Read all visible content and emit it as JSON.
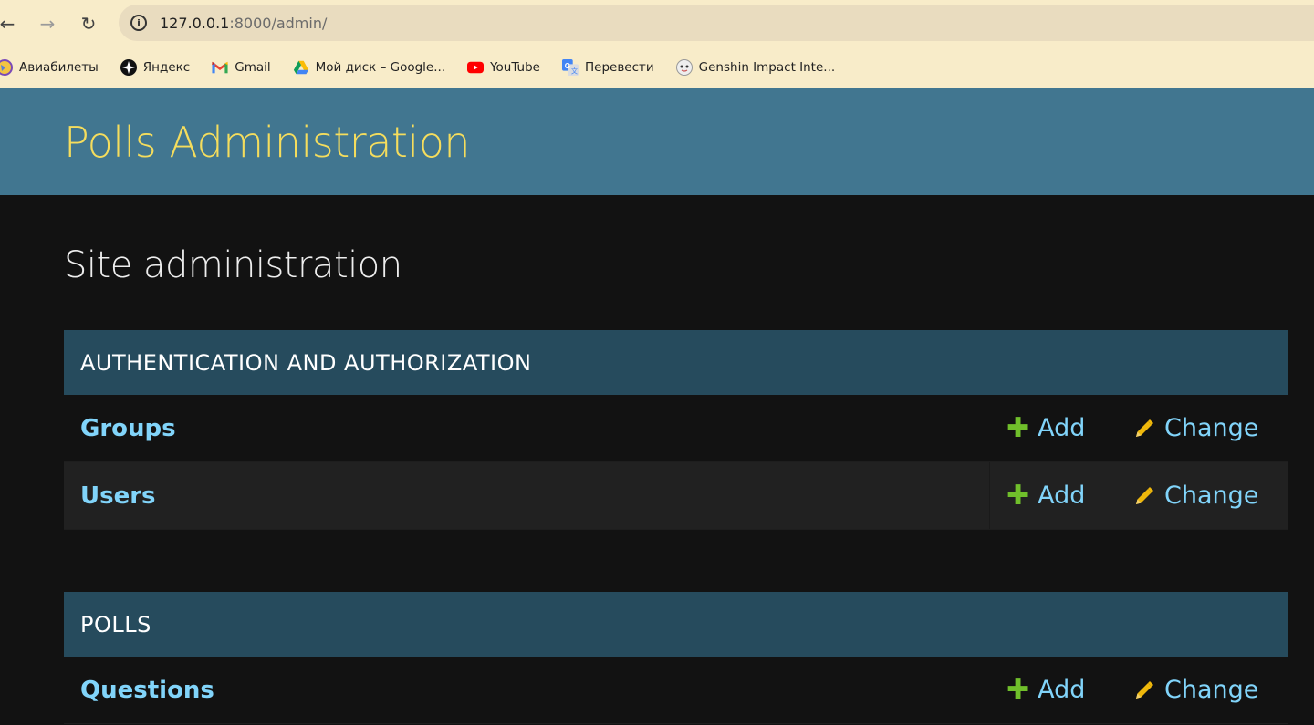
{
  "browser": {
    "url_host": "127.0.0.1",
    "url_path": ":8000/admin/",
    "bookmarks": [
      {
        "label": "Авиабилеты",
        "icon": "globe-icon"
      },
      {
        "label": "Яндекс",
        "icon": "yandex-icon"
      },
      {
        "label": "Gmail",
        "icon": "gmail-icon"
      },
      {
        "label": "Мой диск – Google...",
        "icon": "google-drive-icon"
      },
      {
        "label": "YouTube",
        "icon": "youtube-icon"
      },
      {
        "label": "Перевести",
        "icon": "translate-icon"
      },
      {
        "label": "Genshin Impact Inte...",
        "icon": "genshin-icon"
      }
    ]
  },
  "header": {
    "branding": "Polls Administration"
  },
  "main": {
    "title": "Site administration",
    "modules": [
      {
        "caption": "AUTHENTICATION AND AUTHORIZATION",
        "rows": [
          {
            "name": "Groups",
            "add": "Add",
            "change": "Change"
          },
          {
            "name": "Users",
            "add": "Add",
            "change": "Change"
          }
        ]
      },
      {
        "caption": "POLLS",
        "rows": [
          {
            "name": "Questions",
            "add": "Add",
            "change": "Change"
          }
        ]
      }
    ]
  },
  "colors": {
    "header_bg": "#417690",
    "branding": "#f5dd5d",
    "module_caption_bg": "#264b5d",
    "link": "#81d4fa",
    "add_icon": "#70bf2b",
    "change_icon": "#efb80b"
  }
}
